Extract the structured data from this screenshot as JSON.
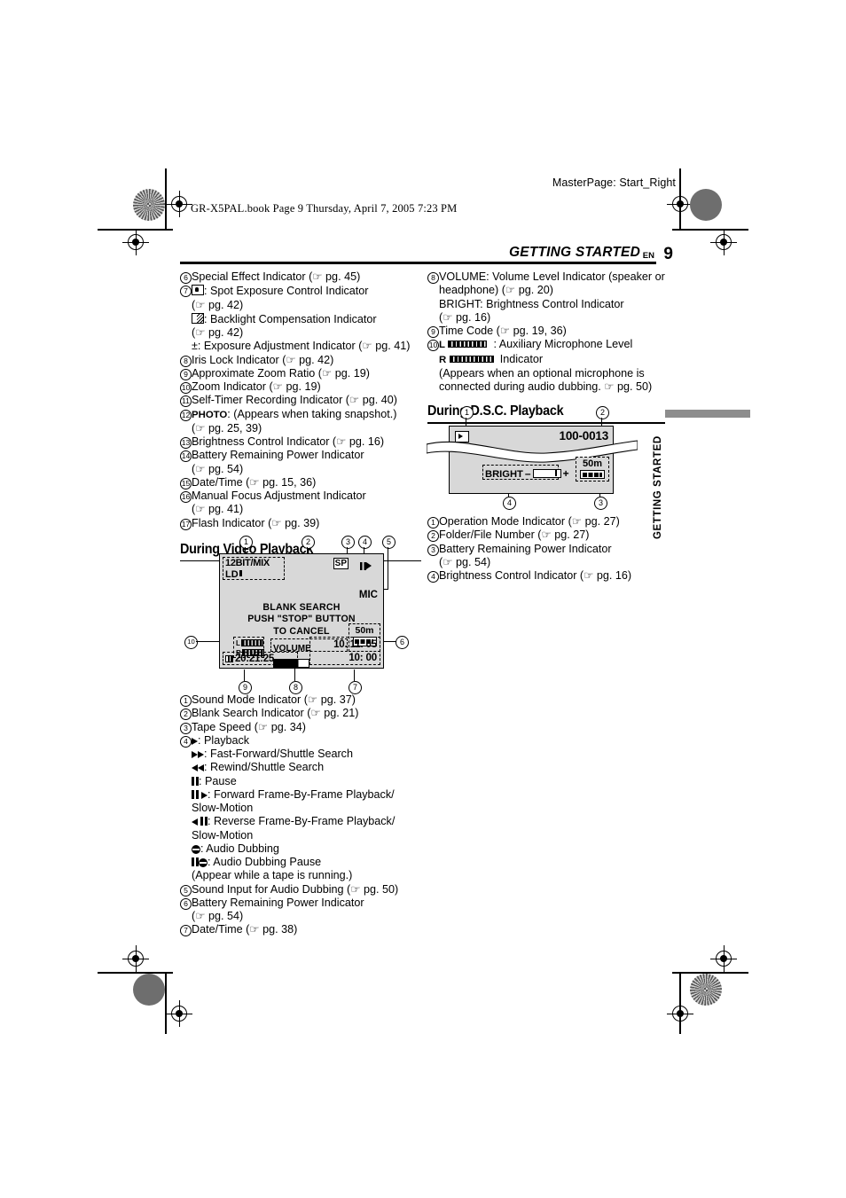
{
  "header": {
    "masterpage": "MasterPage: Start_Right",
    "bookline": "GR-X5PAL.book  Page 9  Thursday, April 7, 2005  7:23 PM",
    "section_title": "GETTING STARTED",
    "en_label": "EN",
    "page_number": "9",
    "side_tab": "GETTING STARTED"
  },
  "left_column": {
    "items": [
      {
        "num": "6",
        "text": "Special Effect Indicator (☞ pg. 45)"
      },
      {
        "num": "7",
        "icon": "spot-exposure-icon",
        "text": ": Spot Exposure Control Indicator"
      },
      {
        "num": "",
        "text": "(☞ pg. 42)",
        "indent": 1
      },
      {
        "num": "",
        "icon": "backlight-icon",
        "text": ": Backlight Compensation Indicator",
        "indent": 1
      },
      {
        "num": "",
        "text": "(☞ pg. 42)",
        "indent": 1
      },
      {
        "num": "",
        "text": "±: Exposure Adjustment Indicator (☞ pg. 41)",
        "indent": 1
      },
      {
        "num": "8",
        "text": "Iris Lock Indicator (☞ pg. 42)"
      },
      {
        "num": "9",
        "text": "Approximate Zoom Ratio (☞ pg. 19)"
      },
      {
        "num": "10",
        "text": "Zoom Indicator (☞ pg. 19)"
      },
      {
        "num": "11",
        "text": "Self-Timer Recording Indicator (☞ pg. 40)"
      },
      {
        "num": "12",
        "bold_lead": "PHOTO",
        "text": ": (Appears when taking snapshot.)"
      },
      {
        "num": "",
        "text": "(☞ pg. 25, 39)",
        "indent": 1
      },
      {
        "num": "13",
        "text": "Brightness Control Indicator (☞ pg. 16)"
      },
      {
        "num": "14",
        "text": "Battery Remaining Power Indicator"
      },
      {
        "num": "",
        "text": "(☞ pg. 54)",
        "indent": 1
      },
      {
        "num": "15",
        "text": "Date/Time (☞ pg. 15, 36)"
      },
      {
        "num": "16",
        "text": "Manual Focus Adjustment Indicator"
      },
      {
        "num": "",
        "text": "(☞ pg. 41)",
        "indent": 1
      },
      {
        "num": "17",
        "text": "Flash Indicator (☞ pg. 39)"
      }
    ]
  },
  "right_column_top": {
    "items": [
      {
        "num": "8",
        "text": "VOLUME: Volume Level Indicator (speaker or"
      },
      {
        "num": "",
        "text": "headphone) (☞ pg. 20)",
        "indent": 1
      },
      {
        "num": "",
        "text": "BRIGHT: Brightness Control Indicator",
        "indent": 1
      },
      {
        "num": "",
        "text": "(☞ pg. 16)",
        "indent": 1
      },
      {
        "num": "9",
        "text": "Time Code (☞ pg. 19, 36)"
      },
      {
        "num": "10",
        "icon": "mic-level-icon",
        "text": ": Auxiliary Microphone Level"
      },
      {
        "num": "",
        "icon": "mic-level-icon-r",
        "text": "Indicator"
      },
      {
        "num": "",
        "text": "(Appears when an optional microphone is",
        "indent": 1
      },
      {
        "num": "",
        "text": "connected during audio dubbing. ☞ pg. 50)",
        "indent": 1
      }
    ]
  },
  "video_playback": {
    "heading": "During Video Playback",
    "lcd": {
      "sound_mode": "12BIT/MIX",
      "sound_mode2": "LD",
      "tape_speed": "SP",
      "transport": "❙❙▶",
      "mic": "MIC",
      "blank_search_line1": "BLANK  SEARCH",
      "blank_search_line2": "PUSH \"STOP\" BUTTON",
      "blank_search_line3": "TO  CANCEL",
      "volume_label": "VOLUME",
      "tape_remaining": "50m",
      "timecode": "20:21:25",
      "date": "10. 11. 05",
      "time": "10: 00",
      "mic_l": "L",
      "mic_r": "R"
    },
    "callouts": [
      "1",
      "2",
      "3",
      "4",
      "5",
      "6",
      "7",
      "8",
      "9",
      "10"
    ],
    "items": [
      {
        "num": "1",
        "text": "Sound Mode Indicator (☞ pg. 37)"
      },
      {
        "num": "2",
        "text": "Blank Search Indicator (☞ pg. 21)"
      },
      {
        "num": "3",
        "text": "Tape Speed (☞ pg. 34)"
      },
      {
        "num": "4",
        "icon": "play-icon",
        "text": ": Playback"
      },
      {
        "num": "",
        "icon": "ff-icon",
        "text": ": Fast-Forward/Shuttle Search",
        "indent": 1
      },
      {
        "num": "",
        "icon": "rew-icon",
        "text": ": Rewind/Shuttle Search",
        "indent": 1
      },
      {
        "num": "",
        "icon": "pause-icon",
        "text": ": Pause",
        "indent": 1
      },
      {
        "num": "",
        "icon": "frame-fwd-icon",
        "text": ": Forward Frame-By-Frame Playback/",
        "indent": 1
      },
      {
        "num": "",
        "text": "Slow-Motion",
        "indent": 1
      },
      {
        "num": "",
        "icon": "frame-rev-icon",
        "text": ": Reverse Frame-By-Frame Playback/",
        "indent": 1
      },
      {
        "num": "",
        "text": "Slow-Motion",
        "indent": 1
      },
      {
        "num": "",
        "icon": "audio-dub-icon",
        "text": ": Audio Dubbing",
        "indent": 1
      },
      {
        "num": "",
        "icon": "audio-dub-pause-icon",
        "text": ": Audio Dubbing Pause",
        "indent": 1
      },
      {
        "num": "",
        "text": "(Appear while a tape is running.)",
        "indent": 1
      },
      {
        "num": "5",
        "text": "Sound Input for Audio Dubbing (☞ pg. 50)"
      },
      {
        "num": "6",
        "text": "Battery Remaining Power Indicator"
      },
      {
        "num": "",
        "text": "(☞ pg. 54)",
        "indent": 1
      },
      {
        "num": "7",
        "text": "Date/Time (☞ pg. 38)"
      }
    ]
  },
  "dsc_playback": {
    "heading": "During D.S.C. Playback",
    "lcd": {
      "mode_icon": "playback-mode-icon",
      "folder_file": "100-0013",
      "bright_label": "BRIGHT",
      "minus": "–",
      "plus": "+",
      "tape_remaining": "50m"
    },
    "callouts": [
      "1",
      "2",
      "3",
      "4"
    ],
    "items": [
      {
        "num": "1",
        "text": "Operation Mode Indicator (☞ pg. 27)"
      },
      {
        "num": "2",
        "text": "Folder/File Number (☞ pg. 27)"
      },
      {
        "num": "3",
        "text": "Battery Remaining Power Indicator"
      },
      {
        "num": "",
        "text": "(☞ pg. 54)",
        "indent": 1
      },
      {
        "num": "4",
        "text": "Brightness Control Indicator (☞ pg. 16)"
      }
    ]
  },
  "colors": {
    "lcd_background": "#d8d8d8",
    "tab_gray": "#8d8d8d",
    "ink": "#000000"
  }
}
